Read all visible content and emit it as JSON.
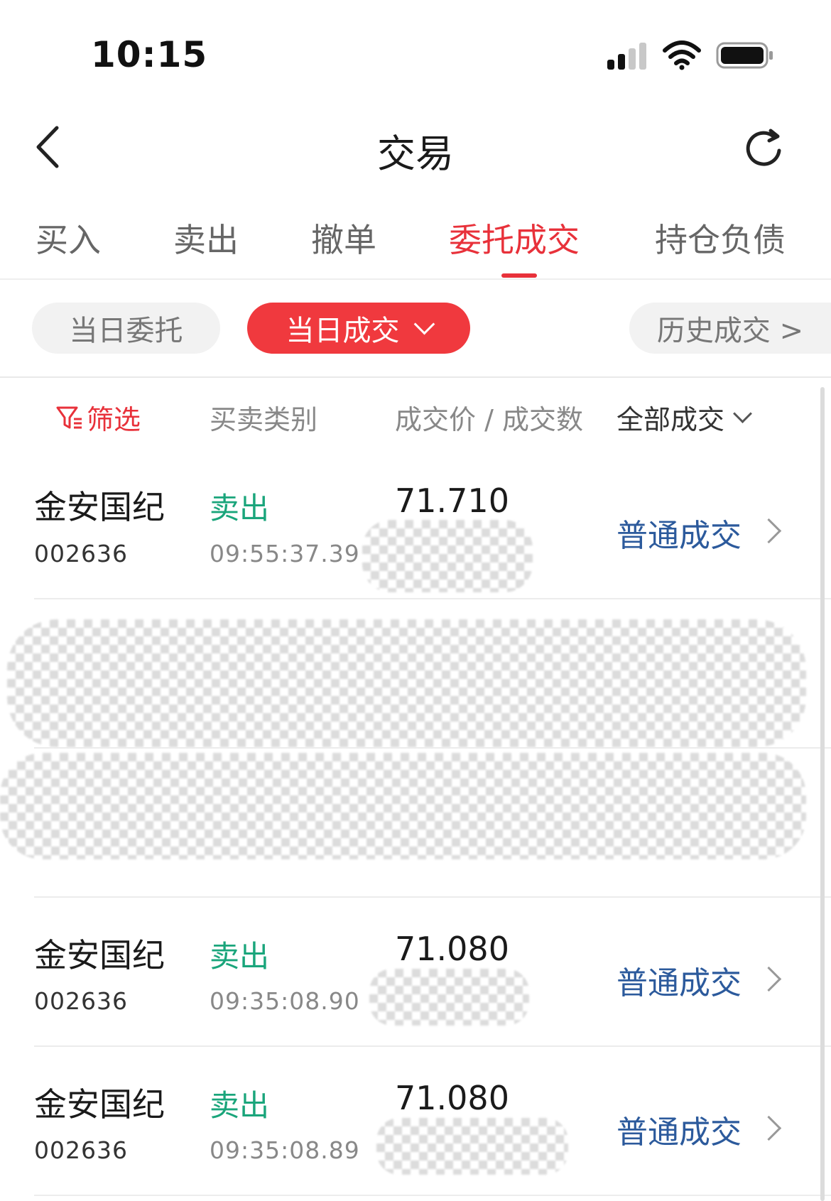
{
  "status_bar": {
    "time": "10:15"
  },
  "header": {
    "title": "交易"
  },
  "tabs": [
    {
      "label": "买入"
    },
    {
      "label": "卖出"
    },
    {
      "label": "撤单"
    },
    {
      "label": "委托成交",
      "active": true
    },
    {
      "label": "持仓负债"
    }
  ],
  "sub_tabs": {
    "today_orders": "当日委托",
    "today_trades": "当日成交",
    "history_trades": "历史成交 >"
  },
  "columns": {
    "filter": "筛选",
    "side": "买卖类别",
    "price_qty": "成交价 / 成交数",
    "all_trades": "全部成交"
  },
  "rows": [
    {
      "name": "金安国纪",
      "code": "002636",
      "side": "卖出",
      "time": "09:55:37.39",
      "price": "71.710",
      "type": "普通成交"
    },
    {
      "name": "金安国纪",
      "code": "002636",
      "side": "卖出",
      "time": "09:35:08.90",
      "price": "71.080",
      "type": "普通成交"
    },
    {
      "name": "金安国纪",
      "code": "002636",
      "side": "卖出",
      "time": "09:35:08.89",
      "price": "71.080",
      "type": "普通成交"
    }
  ],
  "colors": {
    "accent": "#e8313a",
    "sell": "#1aa57b",
    "link": "#2c5a9c"
  }
}
